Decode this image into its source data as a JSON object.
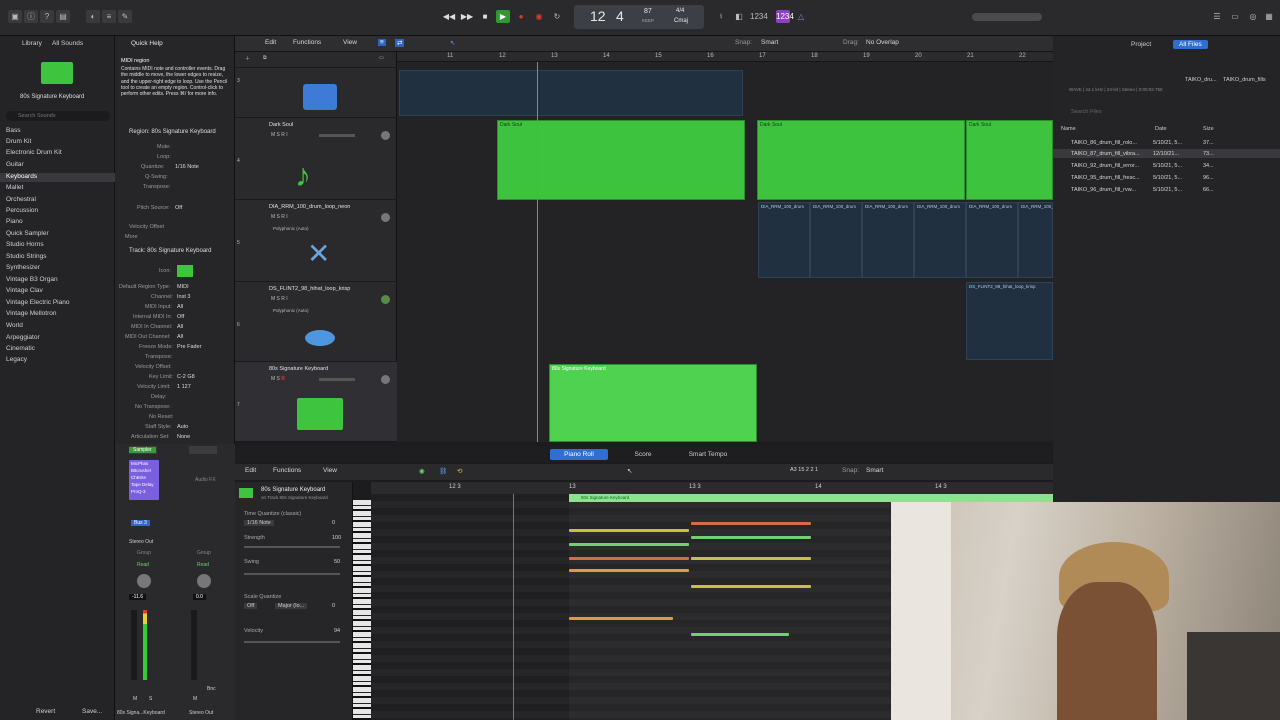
{
  "transport": {
    "bar": "12",
    "beat": "4",
    "tempo": "87",
    "tempo_sub": "KEEP",
    "sig": "4/4",
    "key": "Cmaj"
  },
  "library": {
    "tabs": [
      "Library",
      "All Sounds"
    ],
    "preset_name": "80s Signature Keyboard",
    "search_placeholder": "Search Sounds",
    "items": [
      "Bass",
      "Drum Kit",
      "Electronic Drum Kit",
      "Guitar",
      "Keyboards",
      "Mallet",
      "Orchestral",
      "Percussion",
      "Piano",
      "Quick Sampler",
      "Studio Horns",
      "Studio Strings",
      "Synthesizer",
      "Vintage B3 Organ",
      "Vintage Clav",
      "Vintage Electric Piano",
      "Vintage Mellotron",
      "World",
      "Arpeggiator",
      "Cinematic",
      "Legacy"
    ]
  },
  "quickhelp": {
    "title": "Quick Help",
    "heading": "MIDI region",
    "body": "Contains MIDI note and controller events. Drag the middle to move, the lower edges to resize, and the upper-right edge to loop. Use the Pencil tool to create an empty region. Control-click to perform other edits. Press ⌘/ for more info."
  },
  "inspector": {
    "region_title": "Region: 80s Signature Keyboard",
    "region_params": [
      [
        "Mute:",
        ""
      ],
      [
        "Loop:",
        ""
      ],
      [
        "Quantize:",
        "1/16 Note"
      ],
      [
        "Q-Swing:",
        ""
      ],
      [
        "Transpose:",
        ""
      ],
      [
        "Velocity:",
        ""
      ],
      [
        "Pitch Source:",
        "Off"
      ]
    ],
    "track_title": "Track: 80s Signature Keyboard",
    "track_params": [
      [
        "Icon:",
        ""
      ],
      [
        "Default Region Type:",
        "MIDI"
      ],
      [
        "Channel:",
        "Inst 3"
      ],
      [
        "MIDI Input:",
        "All"
      ],
      [
        "Internal MIDI In:",
        "Off"
      ],
      [
        "MIDI In Channel:",
        "All"
      ],
      [
        "MIDI Out Channel:",
        "All"
      ],
      [
        "Freeze Mode:",
        "Pre Fader"
      ],
      [
        "Transpose:",
        ""
      ],
      [
        "Velocity Offset:",
        ""
      ],
      [
        "Key Limit:",
        "C-2 G8"
      ],
      [
        "Velocity Limit:",
        "1 127"
      ],
      [
        "Delay:",
        ""
      ],
      [
        "No Transpose:",
        ""
      ],
      [
        "No Reset:",
        ""
      ],
      [
        "Staff Style:",
        "Auto"
      ],
      [
        "Articulation Set:",
        "None"
      ]
    ],
    "more": "More",
    "velocity_offset": "Velocity Offset"
  },
  "arrange_menu": {
    "edit": "Edit",
    "functions": "Functions",
    "view": "View",
    "snap_label": "Snap:",
    "snap": "Smart",
    "drag_label": "Drag:",
    "drag": "No Overlap"
  },
  "ruler": [
    "11",
    "12",
    "13",
    "14",
    "15",
    "16",
    "17",
    "18",
    "19",
    "20",
    "21",
    "22"
  ],
  "tracks": [
    {
      "num": "3",
      "name": ""
    },
    {
      "num": "4",
      "name": "Dark Soul"
    },
    {
      "num": "5",
      "name": "DIA_RRM_100_drum_loop_neon"
    },
    {
      "num": "6",
      "name": "DS_FLINT2_98_hihat_loop_krisp"
    },
    {
      "num": "7",
      "name": "80s Signature Keyboard"
    }
  ],
  "track_sub": {
    "t5": "Polyphonic (Auto)",
    "t6": "Polyphonic (Auto)"
  },
  "regions": {
    "dark_soul": "Dark Soul",
    "keyboard": "80s Signature Keyboard",
    "drum": "DIA_RRM_100_drum",
    "hihat": "DS_FLINT2_98_hihat_loop_krisp"
  },
  "editor_tabs": [
    "Piano Roll",
    "Score",
    "Smart Tempo"
  ],
  "pianoroll": {
    "edit": "Edit",
    "functions": "Functions",
    "view": "View",
    "position": "A3  15 2 2 1",
    "snap_label": "Snap:",
    "snap": "Smart",
    "ruler": [
      "12 3",
      "13",
      "13 3",
      "14",
      "14 3"
    ],
    "track_name": "80s Signature Keyboard",
    "track_sub": "on Track 80s Signature Keyboard",
    "region_label": "80s Signature Keyboard",
    "tq_label": "Time Quantize (classic)",
    "tq_value": "1/16 Note",
    "tq_num": "0",
    "strength_label": "Strength",
    "strength": "100",
    "swing_label": "Swing",
    "swing": "50",
    "scale_label": "Scale Quantize",
    "scale_off": "Off",
    "scale_mode": "Major (Io...",
    "scale_num": "0",
    "velocity_label": "Velocity",
    "velocity": "94"
  },
  "mixer": {
    "setting": "Setting",
    "eq": "EQ",
    "plugins": [
      "Sampler",
      "MicPhas",
      "Bitcrusher",
      "ChBrite",
      "Tape Delay",
      "ProQ-3"
    ],
    "audio_fx": "Audio FX",
    "bus": "Bus 3",
    "stereo_out": "Stereo Out",
    "group": "Group",
    "read": "Read",
    "vol1": "-11.6",
    "vol2": "0.0",
    "bnc": "Bnc",
    "mute": "M",
    "solo": "S",
    "ch1": "80s Signa...Keyboard",
    "ch2": "Stereo Out",
    "revert": "Revert",
    "save": "Save..."
  },
  "browser": {
    "tabs": [
      "Project",
      "All Files"
    ],
    "path": "TAIKO_dru...",
    "path2": "TAIKO_drum_fills",
    "info": "WAVE | 44.1 kHz | 24-bit | Stereo | 0:00:02.758",
    "search_placeholder": "Search Files",
    "cols": [
      "Name",
      "Date",
      "Size"
    ],
    "files": [
      [
        "TAIKO_86_drum_fill_rolo...",
        "5/10/21, 5...",
        "37..."
      ],
      [
        "TAIKO_87_drum_fill_vibra...",
        "12/10/21...",
        "73..."
      ],
      [
        "TAIKO_92_drum_fill_error...",
        "5/10/21, 5...",
        "34..."
      ],
      [
        "TAIKO_95_drum_fill_fresc...",
        "5/10/21, 5...",
        "96..."
      ],
      [
        "TAIKO_96_drum_fill_rvw...",
        "5/10/21, 5...",
        "66..."
      ]
    ]
  }
}
